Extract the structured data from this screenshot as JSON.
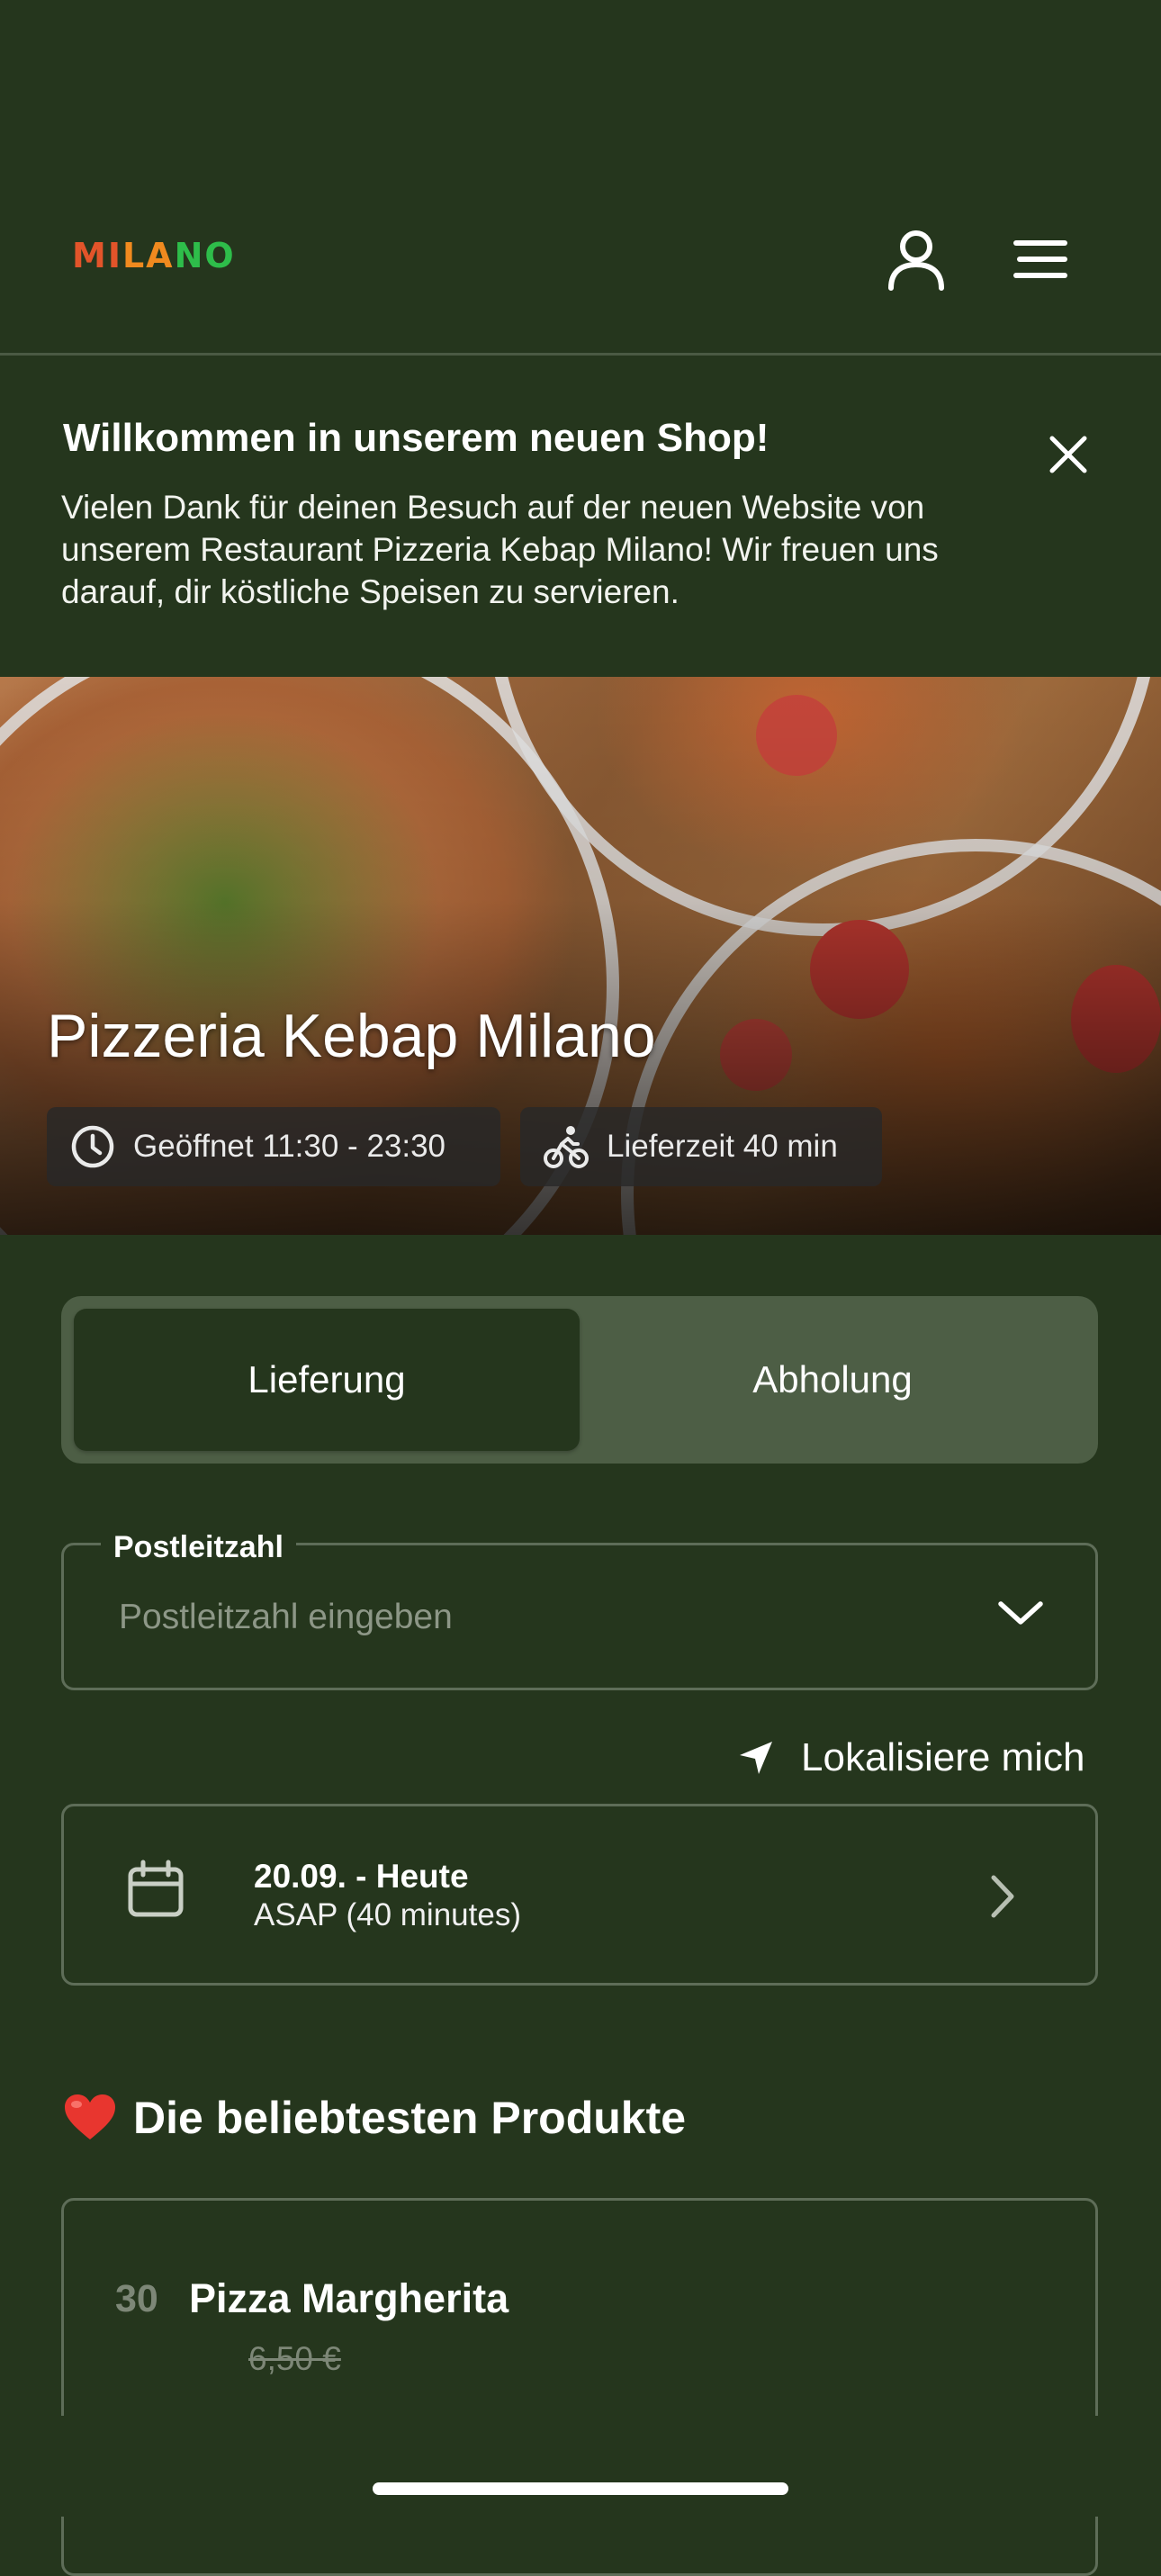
{
  "header": {
    "logo_parts": [
      "MI",
      "LA",
      "NO"
    ],
    "logo_colors": [
      "#e2542a",
      "#f08a1f",
      "#2ebd4a"
    ],
    "icons": [
      "user-icon",
      "menu-icon"
    ]
  },
  "welcome": {
    "title": "Willkommen in unserem neuen Shop!",
    "body": "Vielen Dank für deinen Besuch auf der neuen Website von unserem Restaurant Pizzeria Kebap Milano! Wir freuen uns darauf, dir köstliche Speisen zu servieren.",
    "close_icon": "close-icon"
  },
  "hero": {
    "title": "Pizzeria Kebap Milano",
    "opening_hours": "Geöffnet 11:30 - 23:30",
    "delivery_time": "Lieferzeit 40 min"
  },
  "order_mode": {
    "options": [
      "Lieferung",
      "Abholung"
    ],
    "selected": "Lieferung"
  },
  "postcode": {
    "label": "Postleitzahl",
    "placeholder": "Postleitzahl eingeben",
    "value": ""
  },
  "locate": {
    "label": "Lokalisiere mich"
  },
  "schedule": {
    "date": "20.09. - Heute",
    "time": "ASAP (40 minutes)"
  },
  "popular": {
    "title": "Die beliebtesten Produkte",
    "products": [
      {
        "number": "30",
        "name": "Pizza Margherita",
        "price": "6,50 €"
      }
    ]
  },
  "colors": {
    "background": "#25361d",
    "segment_bg": "#4d5e45",
    "border": "#5e6d58",
    "muted_text": "#7d8777"
  }
}
